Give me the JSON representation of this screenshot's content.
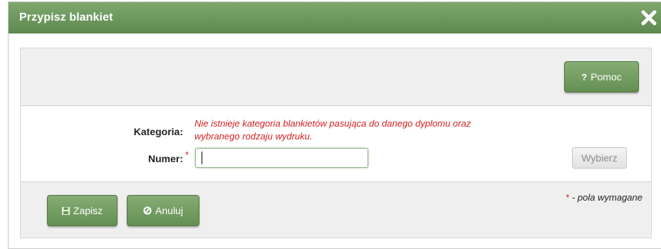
{
  "dialog": {
    "title": "Przypisz blankiet",
    "close_icon": "close-icon"
  },
  "toolbar": {
    "help_label": "Pomoc",
    "help_icon": "question-mark-icon"
  },
  "form": {
    "kategoria_label": "Kategoria:",
    "kategoria_error": "Nie istnieje kategoria blankietów pasująca do danego dyplomu oraz wybranego rodzaju wydruku.",
    "numer_label": "Numer:",
    "numer_required_star": "*",
    "numer_value": "",
    "select_label": "Wybierz"
  },
  "footer": {
    "save_label": "Zapisz",
    "save_icon": "floppy-disk-icon",
    "cancel_label": "Anuluj",
    "cancel_icon": "ban-circle-icon",
    "required_star": "*",
    "required_note": " - pola wymagane"
  },
  "colors": {
    "accent_green": "#6b9559",
    "error_red": "#d42020"
  }
}
